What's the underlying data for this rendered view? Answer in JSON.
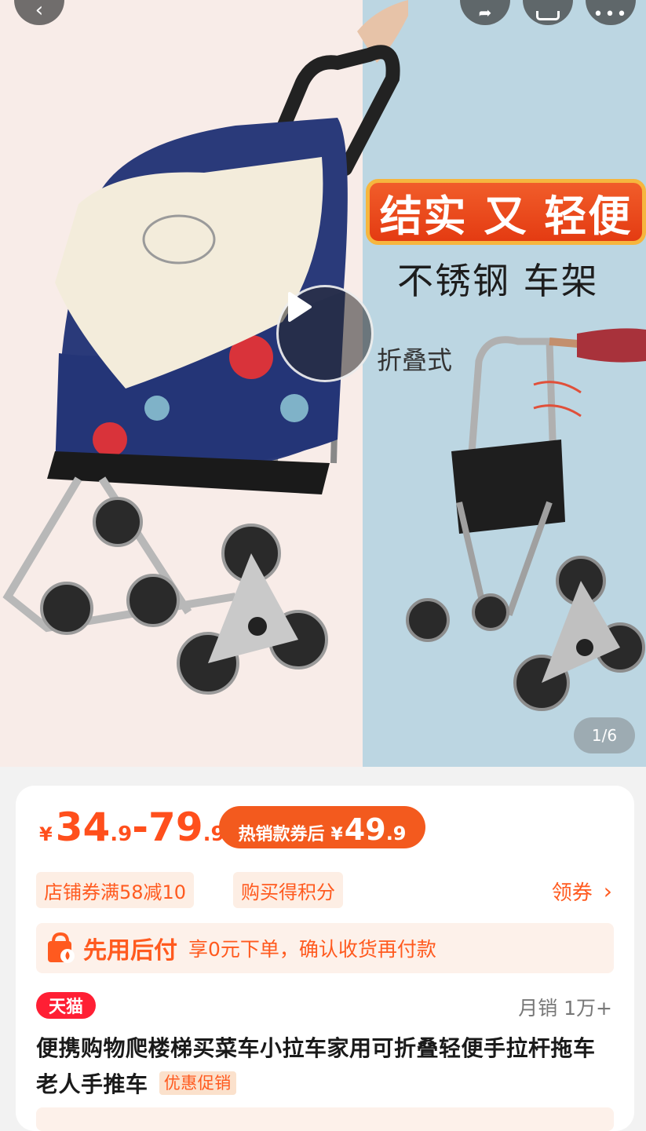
{
  "nav": {
    "back_icon": "chevron-left-icon",
    "share_icon": "share-icon",
    "cart_icon": "cart-icon",
    "more_icon": "more-icon"
  },
  "gallery": {
    "slogan": "结实 又 轻便",
    "sub_slogan": "不锈钢 车架",
    "fold_label": "折叠式",
    "counter": "1/6"
  },
  "price": {
    "yen": "¥",
    "low_int": "34",
    "low_dec": ".9",
    "dash": "-",
    "high_int": "79",
    "high_dec": ".9"
  },
  "promo": {
    "label": "热销款券后",
    "yen": "¥",
    "int": "49",
    "dec": ".9"
  },
  "tags": {
    "shop_coupon": "店铺券满58减10",
    "points": "购买得积分",
    "coupon_link": "领券"
  },
  "pay_later": {
    "title": "先用后付",
    "desc": "享0元下单，确认收货再付款"
  },
  "product": {
    "platform": "天猫",
    "monthly_sales": "月销 1万+",
    "title": "便携购物爬楼梯买菜车小拉车家用可折叠轻便手拉杆拖车老人手推车",
    "title_tag": "优惠促销"
  },
  "colors": {
    "accent": "#ff5a1f",
    "tmall_red": "#ff1f34"
  }
}
